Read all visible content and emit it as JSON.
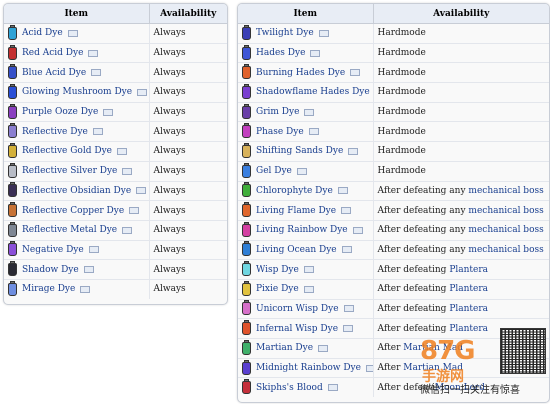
{
  "colors": {
    "header_bg": "#e8edf5",
    "border": "#c8cdd6",
    "link": "#1a3f8f",
    "watermark": "#f07f1e"
  },
  "left_table": {
    "headers": [
      "Item",
      "Availability"
    ],
    "rows": [
      {
        "name": "Acid Dye",
        "availability": "Always",
        "link": "",
        "jar": "#2fa3d6"
      },
      {
        "name": "Red Acid Dye",
        "availability": "Always",
        "link": "",
        "jar": "#c43030"
      },
      {
        "name": "Blue Acid Dye",
        "availability": "Always",
        "link": "",
        "jar": "#3650c9"
      },
      {
        "name": "Glowing Mushroom Dye",
        "availability": "Always",
        "link": "",
        "jar": "#2a4fd6"
      },
      {
        "name": "Purple Ooze Dye",
        "availability": "Always",
        "link": "",
        "jar": "#8a3fc0"
      },
      {
        "name": "Reflective Dye",
        "availability": "Always",
        "link": "",
        "jar": "#8b7fd0"
      },
      {
        "name": "Reflective Gold Dye",
        "availability": "Always",
        "link": "",
        "jar": "#d4b13a"
      },
      {
        "name": "Reflective Silver Dye",
        "availability": "Always",
        "link": "",
        "jar": "#b8bcc6"
      },
      {
        "name": "Reflective Obsidian Dye",
        "availability": "Always",
        "link": "",
        "jar": "#3a2f55"
      },
      {
        "name": "Reflective Copper Dye",
        "availability": "Always",
        "link": "",
        "jar": "#c77235"
      },
      {
        "name": "Reflective Metal Dye",
        "availability": "Always",
        "link": "",
        "jar": "#7f8794"
      },
      {
        "name": "Negative Dye",
        "availability": "Always",
        "link": "",
        "jar": "#8a4fd8"
      },
      {
        "name": "Shadow Dye",
        "availability": "Always",
        "link": "",
        "jar": "#2a2a33"
      },
      {
        "name": "Mirage Dye",
        "availability": "Always",
        "link": "",
        "jar": "#6f8ee0"
      }
    ]
  },
  "right_table": {
    "headers": [
      "Item",
      "Availability"
    ],
    "rows": [
      {
        "name": "Twilight Dye",
        "availability": "Hardmode",
        "link": "",
        "jar": "#3b3fb5"
      },
      {
        "name": "Hades Dye",
        "availability": "Hardmode",
        "link": "",
        "jar": "#3f56d6"
      },
      {
        "name": "Burning Hades Dye",
        "availability": "Hardmode",
        "link": "",
        "jar": "#e0612b"
      },
      {
        "name": "Shadowflame Hades Dye",
        "availability": "Hardmode",
        "link": "",
        "jar": "#7a3fd0"
      },
      {
        "name": "Grim Dye",
        "availability": "Hardmode",
        "link": "",
        "jar": "#6a3fa8"
      },
      {
        "name": "Phase Dye",
        "availability": "Hardmode",
        "link": "",
        "jar": "#c23fbf"
      },
      {
        "name": "Shifting Sands Dye",
        "availability": "Hardmode",
        "link": "",
        "jar": "#d8b25a"
      },
      {
        "name": "Gel Dye",
        "availability": "Hardmode",
        "link": "",
        "jar": "#3a7fe0"
      },
      {
        "name": "Chlorophyte Dye",
        "availability": "After defeating any ",
        "link": "mechanical boss",
        "jar": "#3fae3a"
      },
      {
        "name": "Living Flame Dye",
        "availability": "After defeating any ",
        "link": "mechanical boss",
        "jar": "#e0662b"
      },
      {
        "name": "Living Rainbow Dye",
        "availability": "After defeating any ",
        "link": "mechanical boss",
        "jar": "#d43fa2"
      },
      {
        "name": "Living Ocean Dye",
        "availability": "After defeating any ",
        "link": "mechanical boss",
        "jar": "#2f7fd6"
      },
      {
        "name": "Wisp Dye",
        "availability": "After defeating ",
        "link": "Plantera",
        "jar": "#6fd6e0"
      },
      {
        "name": "Pixie Dye",
        "availability": "After defeating ",
        "link": "Plantera",
        "jar": "#e0c23f"
      },
      {
        "name": "Unicorn Wisp Dye",
        "availability": "After defeating ",
        "link": "Plantera",
        "jar": "#d66fc9"
      },
      {
        "name": "Infernal Wisp Dye",
        "availability": "After defeating ",
        "link": "Plantera",
        "jar": "#e0532b"
      },
      {
        "name": "Martian Dye",
        "availability": "After ",
        "link": "Martian Mad",
        "jar": "#3fb06a"
      },
      {
        "name": "Midnight Rainbow Dye",
        "availability": "After ",
        "link": "Martian Mad",
        "jar": "#5a3fd0"
      },
      {
        "name": "Skiphs's Blood",
        "availability": "After defeati",
        "link": "Moon Lord",
        "jar": "#c42f3a"
      }
    ]
  },
  "watermark": {
    "logo": "87G",
    "sub": "手游网",
    "caption": "微信扫一扫关注有惊喜"
  }
}
